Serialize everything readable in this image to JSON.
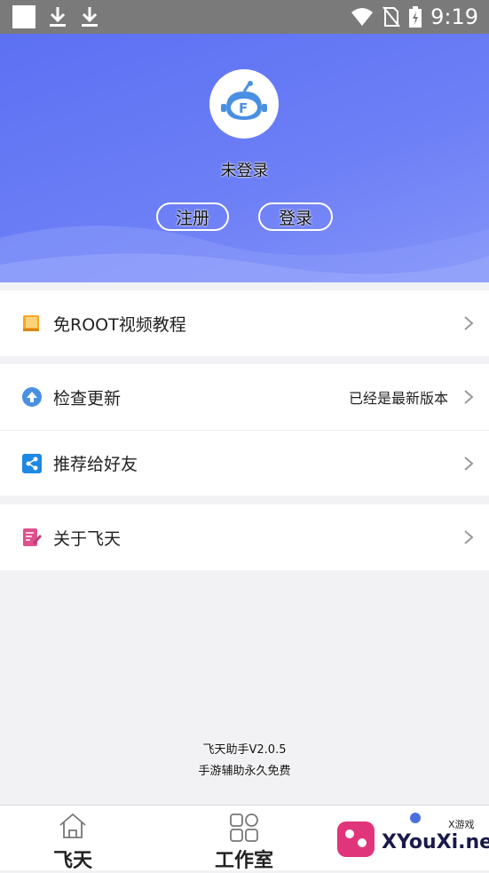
{
  "status_bar": {
    "time": "9:19",
    "icons": [
      "app-square-icon",
      "download-icon",
      "download-icon",
      "wifi-icon",
      "no-sim-icon",
      "battery-charging-icon"
    ]
  },
  "profile": {
    "avatar_icon": "robot-f-logo-icon",
    "username": "未登录",
    "register_label": "注册",
    "login_label": "登录"
  },
  "menu": {
    "tutorial": {
      "label": "免ROOT视频教程",
      "icon": "book-icon"
    },
    "update": {
      "label": "检查更新",
      "status": "已经是最新版本",
      "icon": "upload-arrow-icon"
    },
    "share": {
      "label": "推荐给好友",
      "icon": "share-icon"
    },
    "about": {
      "label": "关于飞天",
      "icon": "edit-note-icon"
    }
  },
  "footer": {
    "version": "飞天助手V2.0.5",
    "slogan": "手游辅助永久免费"
  },
  "tabs": [
    {
      "label": "飞天",
      "icon": "home-icon"
    },
    {
      "label": "工作室",
      "icon": "grid-icon"
    }
  ],
  "watermark": {
    "text": "XYouXi.net",
    "small": "X游戏"
  },
  "colors": {
    "header_start": "#5c70f3",
    "header_end": "#8494f9",
    "accent_blue": "#4a90e2",
    "icon_orange": "#f5a623",
    "icon_pink": "#e0508c"
  }
}
